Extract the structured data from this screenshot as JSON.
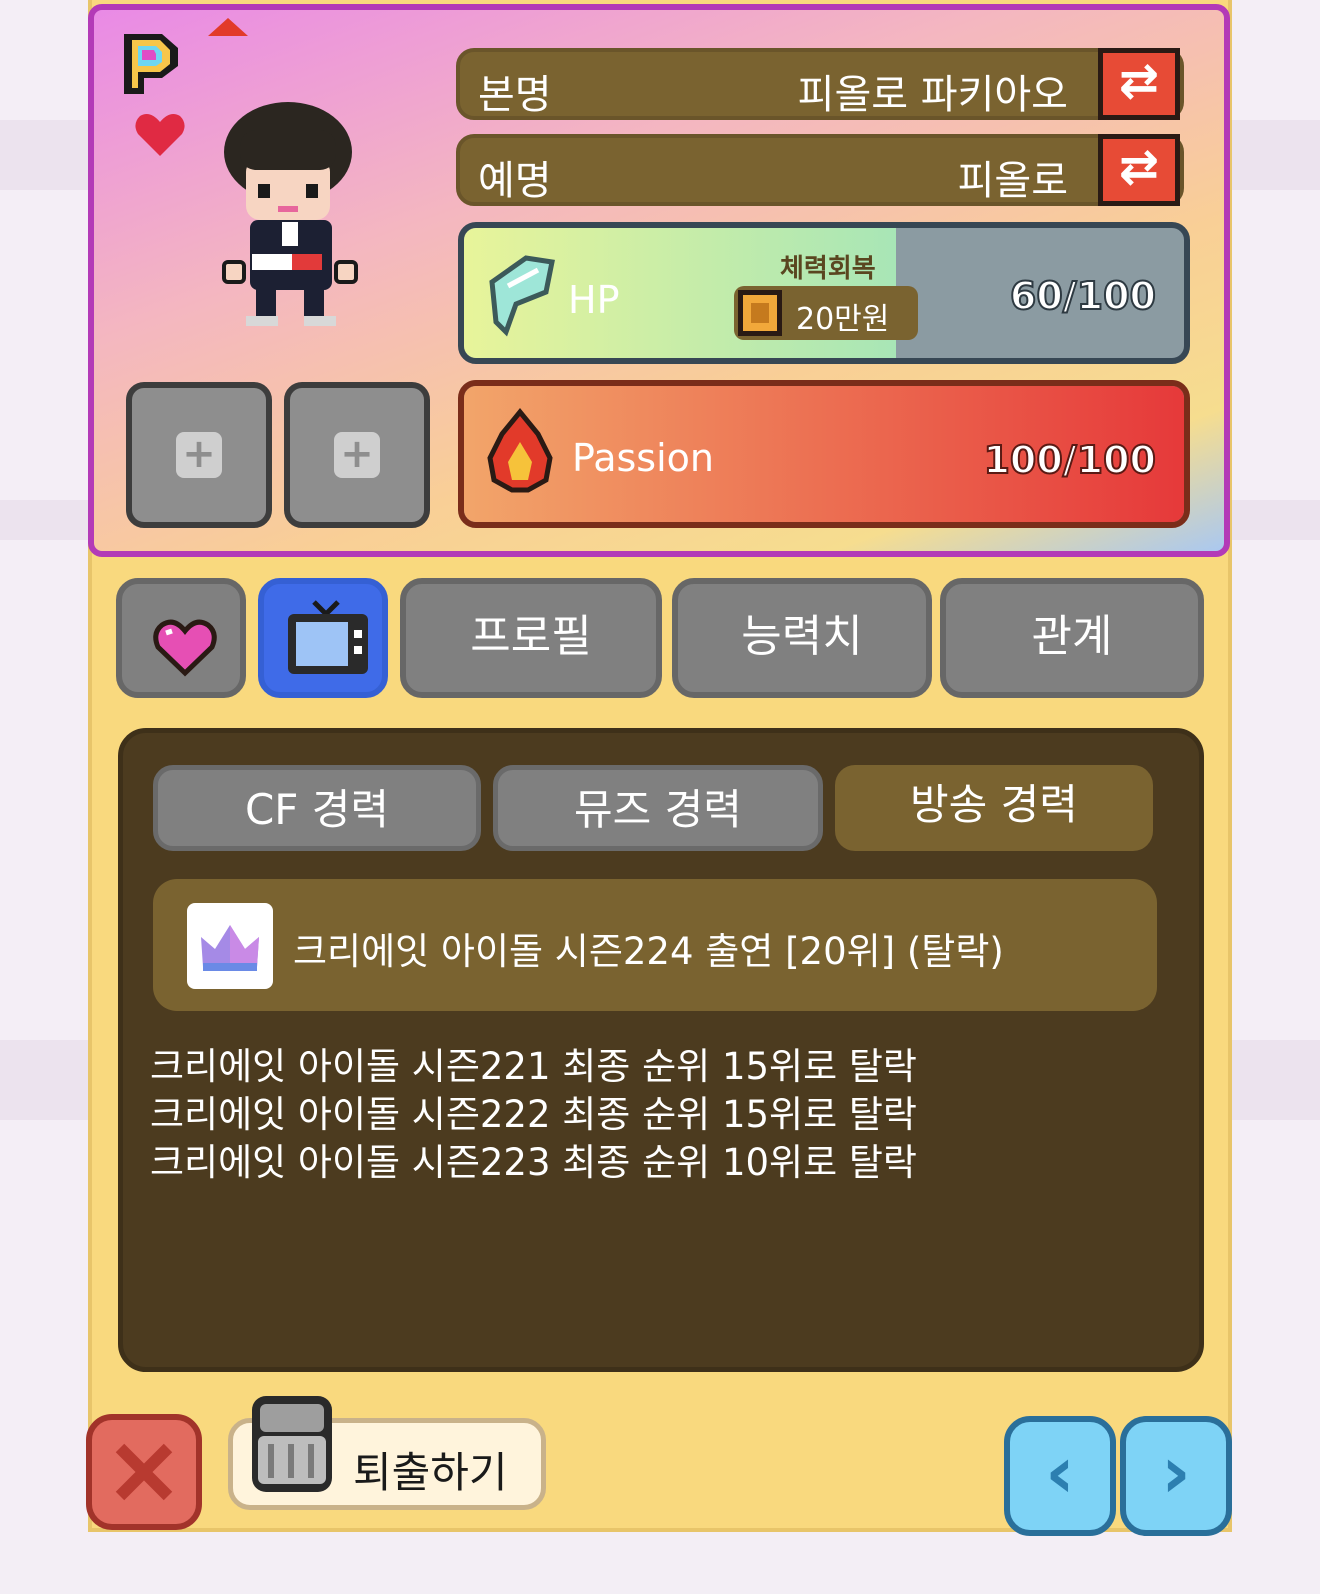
{
  "profile": {
    "real_name_label": "본명",
    "real_name_value": "피올로 파키아오",
    "stage_name_label": "예명",
    "stage_name_value": "피올로"
  },
  "stats": {
    "hp": {
      "label": "HP",
      "recover_label": "체력회복",
      "recover_cost": "20만원",
      "value_text": "60/100",
      "fill_fraction": 0.6,
      "colors": {
        "fill_start": "#e8f49a",
        "fill_end": "#a8e6b6",
        "empty": "#8b9ba2"
      }
    },
    "passion": {
      "label": "Passion",
      "value_text": "100/100",
      "fill_fraction": 1.0,
      "colors": {
        "fill_start": "#f2a56a",
        "fill_end": "#e6393a"
      }
    }
  },
  "tabs": [
    {
      "label": ""
    },
    {
      "label": ""
    },
    {
      "label": "프로필"
    },
    {
      "label": "능력치"
    },
    {
      "label": "관계"
    }
  ],
  "career_tabs": [
    {
      "label": "CF 경력"
    },
    {
      "label": "뮤즈 경력"
    },
    {
      "label": "방송 경력",
      "active": true
    }
  ],
  "highlight_entry": "크리에잇 아이돌 시즌224 출연 [20위] (탈락)",
  "history": [
    "크리에잇 아이돌 시즌221 최종 순위 15위로 탈락",
    "크리에잇 아이돌 시즌222 최종 순위 15위로 탈락",
    "크리에잇 아이돌 시즌223 최종 순위 10위로 탈락"
  ],
  "dismiss_label": "퇴출하기",
  "icons": {
    "logo": "p-logo-icon",
    "heart": "heart-icon",
    "hp": "wing-icon",
    "passion": "flame-icon",
    "coin": "coin-icon",
    "crown": "crown-icon",
    "close": "close-icon",
    "trash": "trash-icon",
    "prev": "chevron-left-icon",
    "next": "chevron-right-icon",
    "tv": "tv-icon"
  },
  "colors": {
    "panel": "#f9d97e",
    "card_border": "#b33ab7",
    "name_row": "#7a6330",
    "swap_button": "#e74b36",
    "tab_inactive": "#808080",
    "tab_tv_active": "#3f6be8",
    "career_active": "#7a6330",
    "content_bg": "#4c3b1f",
    "nav_button": "#7ed3f6",
    "close_button": "#e26b5f"
  }
}
